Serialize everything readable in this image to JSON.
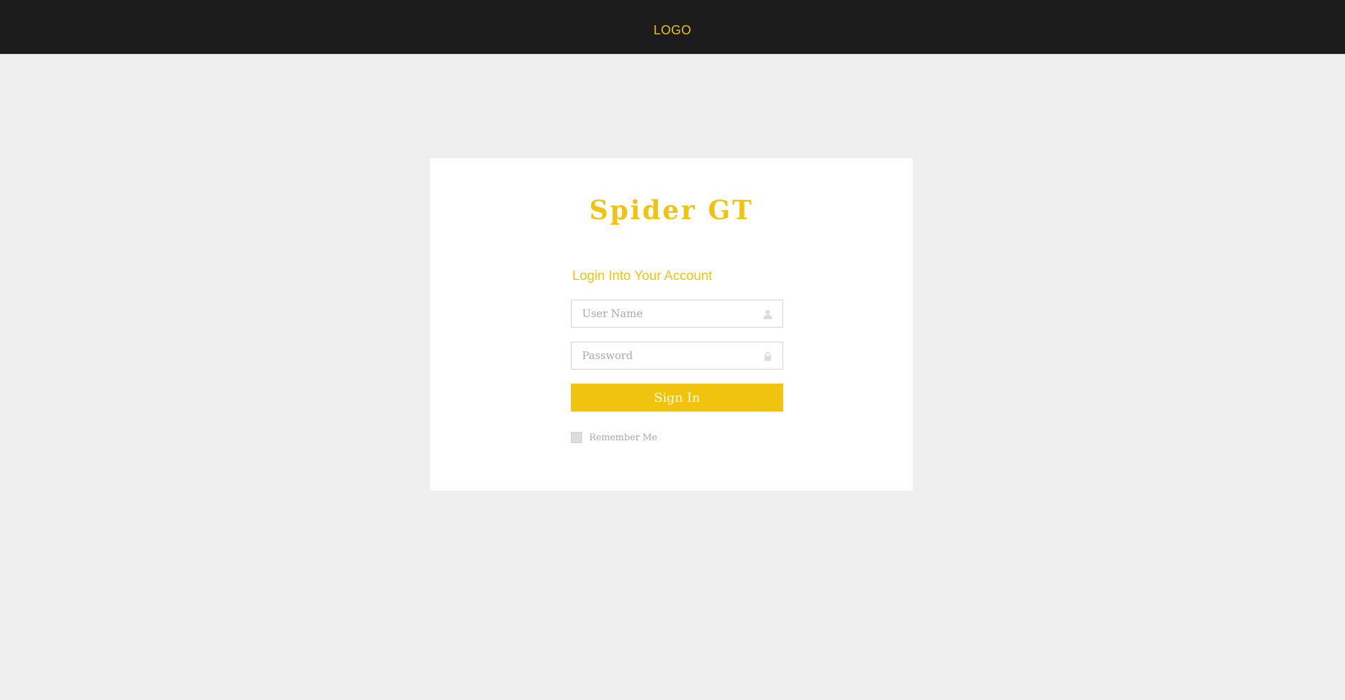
{
  "header": {
    "logo_text": "LOGO"
  },
  "login": {
    "brand": "Spider GT",
    "title": "Login Into Your Account",
    "username": {
      "placeholder": "User Name",
      "value": "",
      "icon": "user-icon"
    },
    "password": {
      "placeholder": "Password",
      "value": "",
      "icon": "lock-icon"
    },
    "sign_in_label": "Sign In",
    "remember_label": "Remember Me",
    "remember_checked": false
  },
  "colors": {
    "accent": "#f0c30f",
    "header_bg": "#1c1c1c",
    "page_bg": "#efefef",
    "card_bg": "#ffffff"
  }
}
